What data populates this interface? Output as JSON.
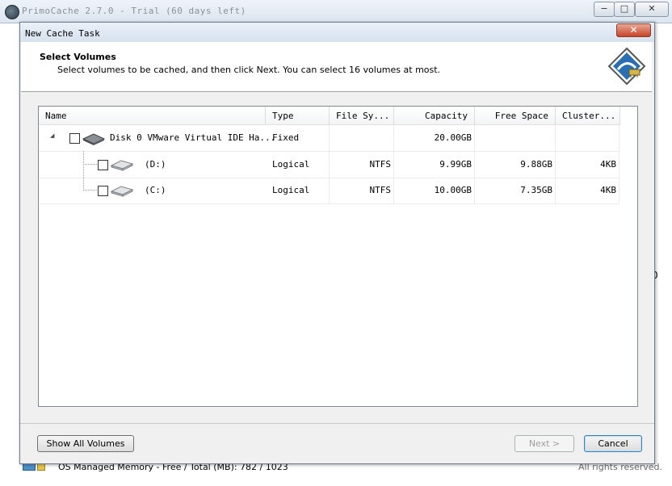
{
  "app": {
    "title": "PrimoCache 2.7.0 - Trial (60 days left)",
    "min_glyph": "−",
    "max_glyph": "□",
    "close_glyph": "✕",
    "right_edge_text": "0",
    "status_memory": "OS Managed Memory - Free / Total (MB):   782 / 1023",
    "status_rights": "All rights reserved."
  },
  "dialog": {
    "title": "New Cache Task",
    "close_glyph": "✕",
    "header_title": "Select Volumes",
    "header_subtitle": "Select volumes to be cached, and then click Next. You can select 16 volumes at most.",
    "icon": "wizard-disk-icon",
    "buttons": {
      "show_all": "Show All Volumes",
      "next": "Next >",
      "cancel": "Cancel"
    }
  },
  "table": {
    "columns": [
      "Name",
      "Type",
      "File Sy...",
      "Capacity",
      "Free Space",
      "Cluster..."
    ],
    "rows": [
      {
        "name": "Disk 0 VMware Virtual IDE Ha...",
        "type": "Fixed",
        "fs": "",
        "capacity": "20.00GB",
        "free": "",
        "cluster": "",
        "expanded_glyph": "◢"
      },
      {
        "name": "(D:)",
        "type": "Logical",
        "fs": "NTFS",
        "capacity": "9.99GB",
        "free": "9.88GB",
        "cluster": "4KB"
      },
      {
        "name": "(C:)",
        "type": "Logical",
        "fs": "NTFS",
        "capacity": "10.00GB",
        "free": "7.35GB",
        "cluster": "4KB"
      }
    ]
  }
}
